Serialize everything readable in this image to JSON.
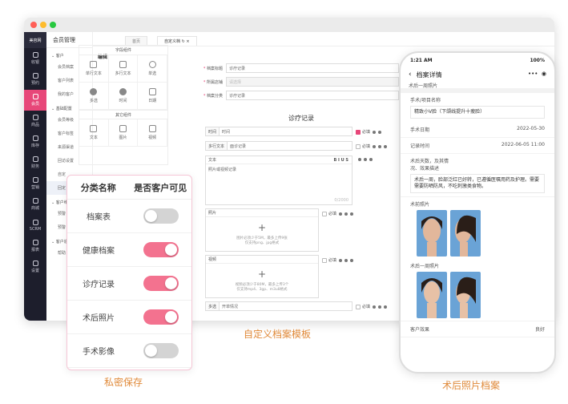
{
  "app": {
    "logo": "美容网",
    "module": "会员管理"
  },
  "nav": [
    {
      "label": "收银",
      "icon": "cashier-icon"
    },
    {
      "label": "预约",
      "icon": "clock-icon"
    },
    {
      "label": "会员",
      "icon": "home-icon"
    },
    {
      "label": "商品",
      "icon": "box-icon"
    },
    {
      "label": "库存",
      "icon": "warehouse-icon"
    },
    {
      "label": "财务",
      "icon": "finance-icon"
    },
    {
      "label": "营销",
      "icon": "marketing-icon"
    },
    {
      "label": "商城",
      "icon": "mall-icon"
    },
    {
      "label": "SCRM",
      "icon": "scrm-icon"
    },
    {
      "label": "报表",
      "icon": "report-icon"
    },
    {
      "label": "设置",
      "icon": "settings-icon"
    }
  ],
  "sidebar": {
    "group1": "客户",
    "items1": [
      "会员档案",
      "客户列表",
      "我的客户"
    ],
    "group2": "基础配置",
    "items2": [
      "会员等级",
      "客户标签",
      "来源渠道",
      "回访设置",
      "自定",
      "回定"
    ],
    "group3": "客户维",
    "items3": [
      "预警",
      "预警"
    ],
    "group4": "客户追",
    "items4": [
      "帮助",
      "帮助"
    ]
  },
  "tabs": {
    "home": "首页",
    "active": "自定义档"
  },
  "editor": {
    "section": "编辑",
    "field_components": "字段组件",
    "other_components": "其它组件",
    "fields": [
      "单行文本",
      "多行文本",
      "单选",
      "多选",
      "时间",
      "日期"
    ],
    "others": [
      "文本",
      "图片",
      "视频"
    ],
    "props": [
      {
        "label": "档案标题",
        "value": "诊疗记录",
        "disabled": false
      },
      {
        "label": "所属店铺",
        "value": "请选择",
        "disabled": true
      },
      {
        "label": "档案分类",
        "value": "诊疗记录",
        "disabled": false
      }
    ],
    "canvas_title": "诊疗记录",
    "rows": {
      "time_label": "时间",
      "time_value": "时间",
      "multi_label": "多行文本",
      "multi_value": "面诊记录",
      "text_label": "文本",
      "text_value": "照片或视频记录",
      "text_counter": "0/2000",
      "photo_label": "照片",
      "photo_hint1": "图片必须少于5M，最多上传9张",
      "photo_hint2": "仅支持png、jpg格式",
      "video_label": "视频",
      "video_hint1": "视频必须少于80M，最多上传3个",
      "video_hint2": "仅支持mp4、3gp、m3u8格式",
      "radio_label": "多选",
      "radio_value": "开单情况"
    },
    "required_label": "必填",
    "plus": "+",
    "toolbar": "B  I  U  S"
  },
  "privacy": {
    "col1": "分类名称",
    "col2": "是否客户可见",
    "rows": [
      {
        "name": "档案表",
        "on": false
      },
      {
        "name": "健康档案",
        "on": true
      },
      {
        "name": "诊疗记录",
        "on": true
      },
      {
        "name": "术后照片",
        "on": true
      },
      {
        "name": "手术影像",
        "on": false
      }
    ]
  },
  "captions": {
    "left": "私密保存",
    "center": "自定义档案模板",
    "right": "术后照片档案"
  },
  "phone": {
    "time": "1:21 AM",
    "battery": "100%",
    "title": "档案详情",
    "subtitle": "术后一周照片",
    "project_label": "手术/项目名称",
    "project_value": "精致小V脸（下颌线提升十瘦脸）",
    "surgery_date_label": "手术日期",
    "surgery_date": "2022-05-30",
    "record_time_label": "记录时间",
    "record_time": "2022-06-05 11:00",
    "recovery_label1": "术后天数，及其情",
    "recovery_label2": "况、效果描述",
    "recovery_text": "术后一周，脸部泛红已好转，已遵循医嘱用药及护理。需要需要防晒防风，不吃刺激类食物。",
    "photos_label": "术前照片",
    "week_label": "术后一周照片",
    "effect_label": "客户效果",
    "effect_value": "良好"
  }
}
